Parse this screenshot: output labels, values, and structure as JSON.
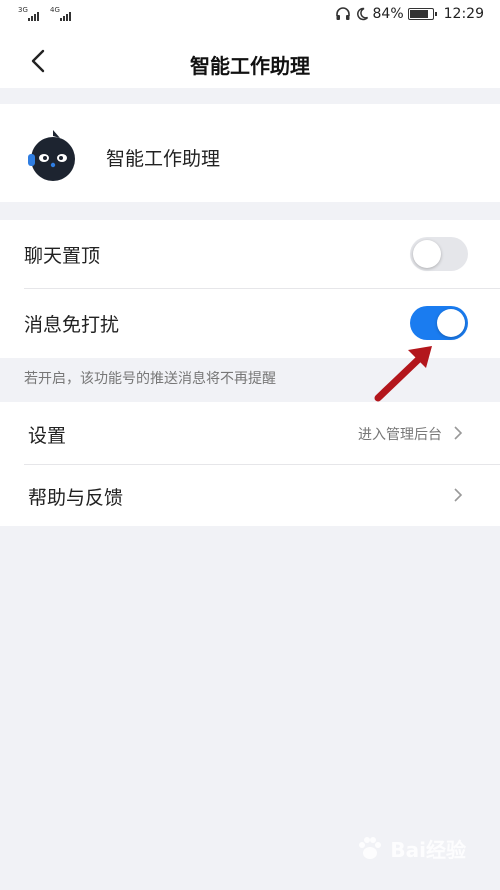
{
  "status_bar": {
    "signal1_label": "3G",
    "signal2_label": "4G",
    "battery_percent": "84%",
    "battery_level": 0.84,
    "time": "12:29",
    "icons": [
      "headphones-icon",
      "moon-icon",
      "battery-icon"
    ]
  },
  "nav": {
    "title": "智能工作助理",
    "back_icon": "chevron-left-icon"
  },
  "profile": {
    "name": "智能工作助理",
    "avatar_icon": "robot-avatar-icon"
  },
  "toggles": [
    {
      "label": "聊天置顶",
      "enabled": false
    },
    {
      "label": "消息免打扰",
      "enabled": true
    }
  ],
  "hint_text": "若开启，该功能号的推送消息将不再提醒",
  "menu": [
    {
      "label": "设置",
      "value": "进入管理后台"
    },
    {
      "label": "帮助与反馈",
      "value": ""
    }
  ],
  "colors": {
    "accent": "#1a7cf0",
    "background": "#f1f2f6",
    "annotation_arrow": "#b3161c"
  },
  "watermark": {
    "text": "Bai经验"
  }
}
